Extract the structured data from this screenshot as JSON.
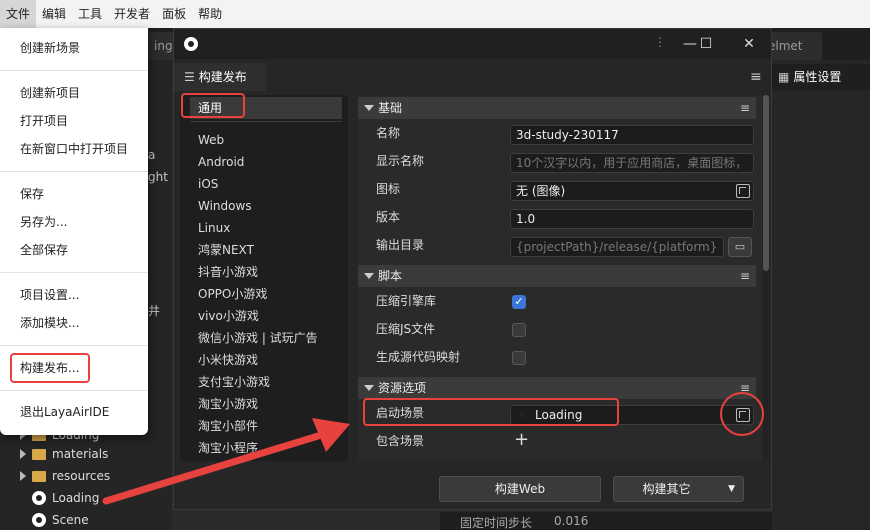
{
  "menubar": {
    "items": [
      "文件",
      "编辑",
      "工具",
      "开发者",
      "面板",
      "帮助"
    ]
  },
  "dropdown": {
    "groups": [
      [
        "创建新场景"
      ],
      [
        "创建新项目",
        "打开项目",
        "在新窗口中打开项目"
      ],
      [
        "保存",
        "另存为...",
        "全部保存"
      ],
      [
        "项目设置...",
        "添加模块..."
      ],
      [
        "构建发布..."
      ],
      [
        "退出LayaAirIDE"
      ]
    ]
  },
  "background": {
    "tab_partial_left": "ing",
    "tab_partial_right": "elmet",
    "left_partial_a": "a",
    "left_partial_b": "ght",
    "left_partial_c": "井",
    "props_title": "属性设置",
    "tree": [
      {
        "label": "Loading",
        "type": "folder-partial"
      },
      {
        "label": "materials",
        "type": "folder"
      },
      {
        "label": "resources",
        "type": "folder"
      },
      {
        "label": "Loading",
        "type": "scene"
      },
      {
        "label": "Scene",
        "type": "scene"
      }
    ],
    "bottom_label": "固定时间步长",
    "bottom_value": "0.016"
  },
  "window": {
    "tab_title": "构建发布",
    "categories": [
      "通用",
      "Web",
      "Android",
      "iOS",
      "Windows",
      "Linux",
      "鸿蒙NEXT",
      "抖音小游戏",
      "OPPO小游戏",
      "vivo小游戏",
      "微信小游戏 | 试玩广告",
      "小米快游戏",
      "支付宝小游戏",
      "淘宝小游戏",
      "淘宝小部件",
      "淘宝小程序"
    ],
    "sections": {
      "basic": "基础",
      "script": "脚本",
      "assets": "资源选项"
    },
    "basic": {
      "name_label": "名称",
      "name_value": "3d-study-230117",
      "display_label": "显示名称",
      "display_placeholder": "10个汉字以内，用于应用商店，桌面图标，",
      "icon_label": "图标",
      "icon_value": "无 (图像)",
      "version_label": "版本",
      "version_value": "1.0",
      "output_label": "输出目录",
      "output_placeholder": "{projectPath}/release/{platform}"
    },
    "script": {
      "compress_engine": "压缩引擎库",
      "compress_engine_checked": true,
      "compress_js": "压缩JS文件",
      "compress_js_checked": false,
      "sourcemap": "生成源代码映射",
      "sourcemap_checked": false
    },
    "assets": {
      "start_scene_label": "启动场景",
      "start_scene_value": "Loading",
      "include_scene_label": "包含场景"
    },
    "buttons": {
      "build_web": "构建Web",
      "build_other": "构建其它"
    }
  },
  "colors": {
    "accent_red": "#e8423f",
    "checkbox_blue": "#3a76d6"
  }
}
